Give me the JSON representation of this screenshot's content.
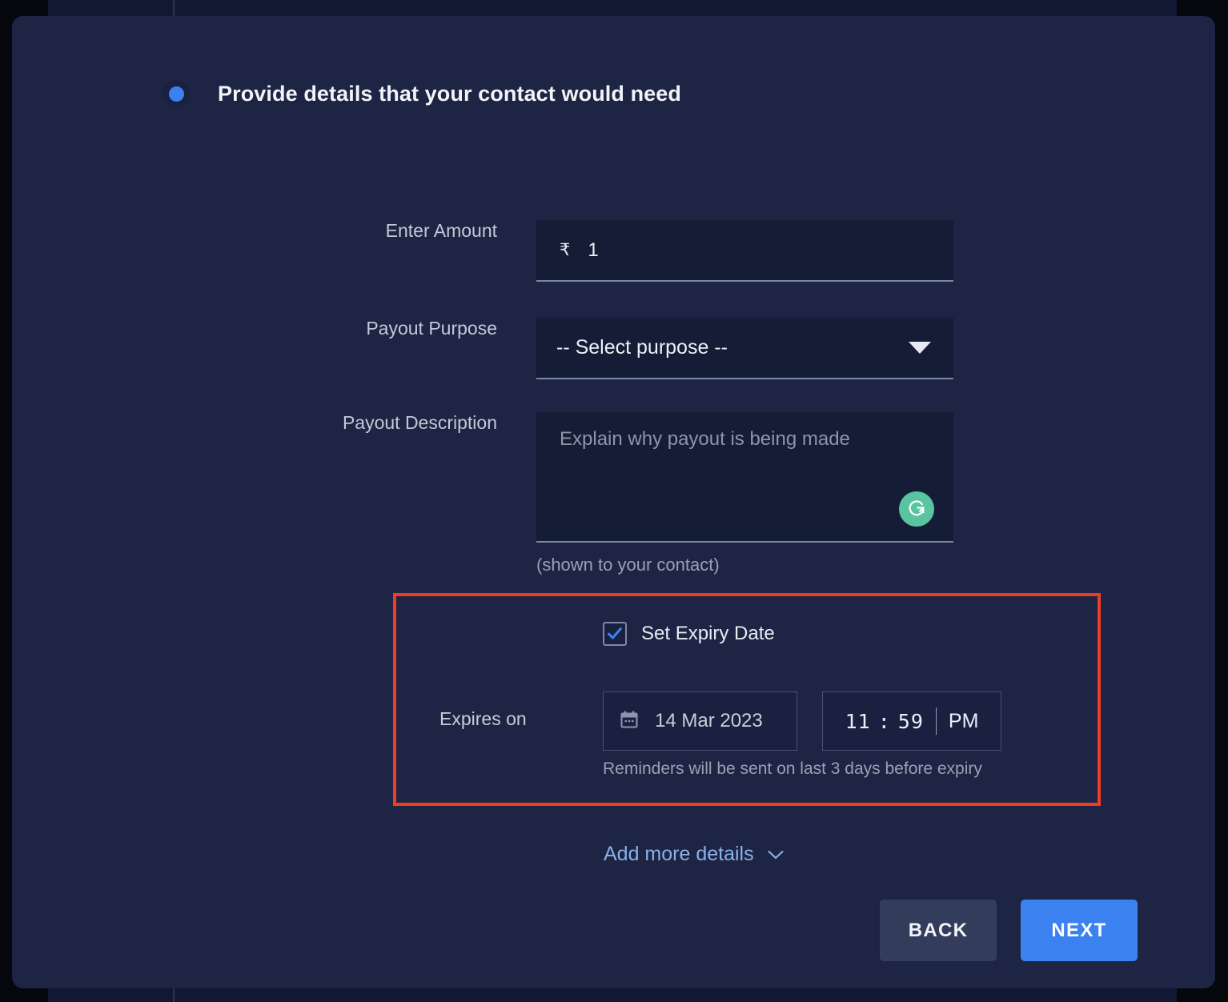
{
  "step": {
    "title": "Provide details that your contact would need",
    "dot_color": "#3b82f0"
  },
  "form": {
    "amount": {
      "label": "Enter Amount",
      "currency_symbol": "₹",
      "value": "1"
    },
    "purpose": {
      "label": "Payout Purpose",
      "selected": "-- Select purpose --"
    },
    "description": {
      "label": "Payout Description",
      "placeholder": "Explain why payout is being made",
      "value": "",
      "hint": "(shown to your contact)",
      "assistant_icon": "grammarly-icon",
      "assistant_color": "#5ac4a0"
    }
  },
  "expiry": {
    "highlight_color": "#ee3d23",
    "checkbox_label": "Set Expiry Date",
    "checkbox_checked": true,
    "expires_on_label": "Expires on",
    "date_value": "14 Mar 2023",
    "time_hour": "11",
    "time_separator": ":",
    "time_minute": "59",
    "meridiem": "PM",
    "reminder_note": "Reminders will be sent on last 3 days before expiry"
  },
  "add_more": {
    "label": "Add more details",
    "color": "#8ab0e8"
  },
  "actions": {
    "back_label": "BACK",
    "next_label": "NEXT",
    "next_color": "#3b82f0",
    "back_color": "#343c5c"
  }
}
